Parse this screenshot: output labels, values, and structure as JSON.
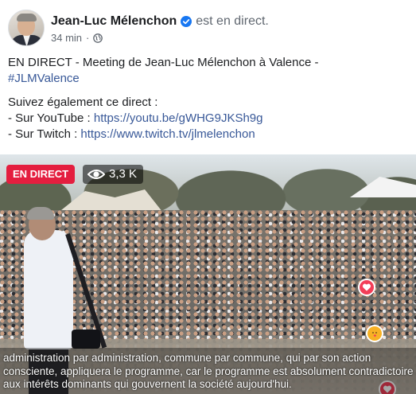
{
  "header": {
    "author": "Jean-Luc Mélenchon",
    "status": "est en direct.",
    "time": "34 min",
    "separator": "·",
    "verified_icon": "verified-badge-icon",
    "privacy_icon": "globe-icon"
  },
  "post": {
    "line1": "EN DIRECT - Meeting de Jean-Luc Mélenchon à Valence -",
    "hashtag": "#JLMValence",
    "line3": "Suivez également ce direct :",
    "youtube_prefix": "- Sur YouTube : ",
    "youtube_link": "https://youtu.be/gWHG9JKSh9g",
    "twitch_prefix": "- Sur Twitch : ",
    "twitch_link": "https://www.twitch.tv/jlmelenchon"
  },
  "video": {
    "live_badge": "EN DIRECT",
    "viewer_count": "3,3 K",
    "viewer_icon": "eye-icon",
    "captions": [
      "administration par administration, commune par commune, qui par son action",
      "consciente, appliquera le programme, car le programme est absolument contradictoire",
      "aux intérêts dominants qui gouvernent la société aujourd'hui."
    ],
    "reactions": [
      "heart-reaction-icon",
      "care-reaction-icon",
      "heart-reaction-icon"
    ]
  },
  "colors": {
    "link": "#385898",
    "live_red": "#e41e3f",
    "verified_blue": "#1877f2",
    "secondary_text": "#606770"
  }
}
